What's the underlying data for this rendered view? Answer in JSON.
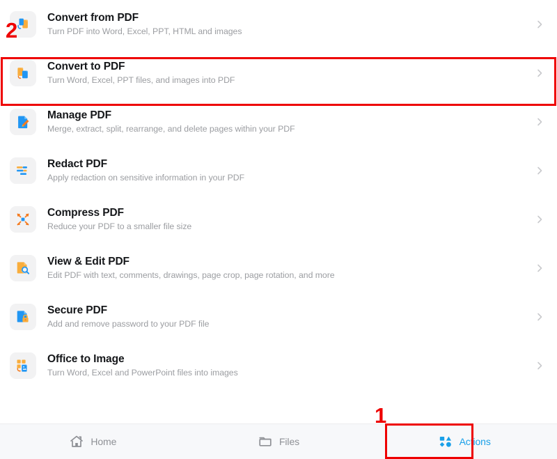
{
  "screen": {
    "name": "PDF Actions",
    "background": "#ffffff",
    "accent_blue": "#2196f3",
    "accent_orange": "#f9ad3c",
    "annotation_red": "#ee0000",
    "tile_background": "#f2f2f3"
  },
  "actions": [
    {
      "title": "Convert from PDF",
      "subtitle": "Turn PDF into Word, Excel, PPT, HTML and images",
      "icon": "convert-from-pdf-icon",
      "chevron": "chevron-right-icon"
    },
    {
      "title": "Convert to PDF",
      "subtitle": "Turn Word, Excel, PPT files, and images into PDF",
      "icon": "convert-to-pdf-icon",
      "chevron": "chevron-right-icon"
    },
    {
      "title": "Manage PDF",
      "subtitle": "Merge, extract, split, rearrange, and delete pages within your PDF",
      "icon": "manage-pdf-icon",
      "chevron": "chevron-right-icon"
    },
    {
      "title": "Redact PDF",
      "subtitle": "Apply redaction on sensitive information in your PDF",
      "icon": "redact-pdf-icon",
      "chevron": "chevron-right-icon"
    },
    {
      "title": "Compress PDF",
      "subtitle": "Reduce your PDF to a smaller file size",
      "icon": "compress-pdf-icon",
      "chevron": "chevron-right-icon"
    },
    {
      "title": "View & Edit PDF",
      "subtitle": "Edit PDF with text, comments, drawings, page crop, page rotation, and more",
      "icon": "view-edit-pdf-icon",
      "chevron": "chevron-right-icon"
    },
    {
      "title": "Secure PDF",
      "subtitle": "Add and remove password to your PDF file",
      "icon": "secure-pdf-icon",
      "chevron": "chevron-right-icon"
    },
    {
      "title": "Office to Image",
      "subtitle": "Turn Word, Excel and PowerPoint files into images",
      "icon": "office-to-image-icon",
      "chevron": "chevron-right-icon"
    }
  ],
  "tabbar": {
    "tabs": [
      {
        "label": "Home",
        "icon": "home-icon",
        "active": false
      },
      {
        "label": "Files",
        "icon": "folder-icon",
        "active": false
      },
      {
        "label": "Actions",
        "icon": "shapes-icon",
        "active": true
      }
    ]
  },
  "annotations": [
    {
      "number": "1",
      "target": "actions-tab"
    },
    {
      "number": "2",
      "target": "convert-from-pdf-row"
    }
  ]
}
